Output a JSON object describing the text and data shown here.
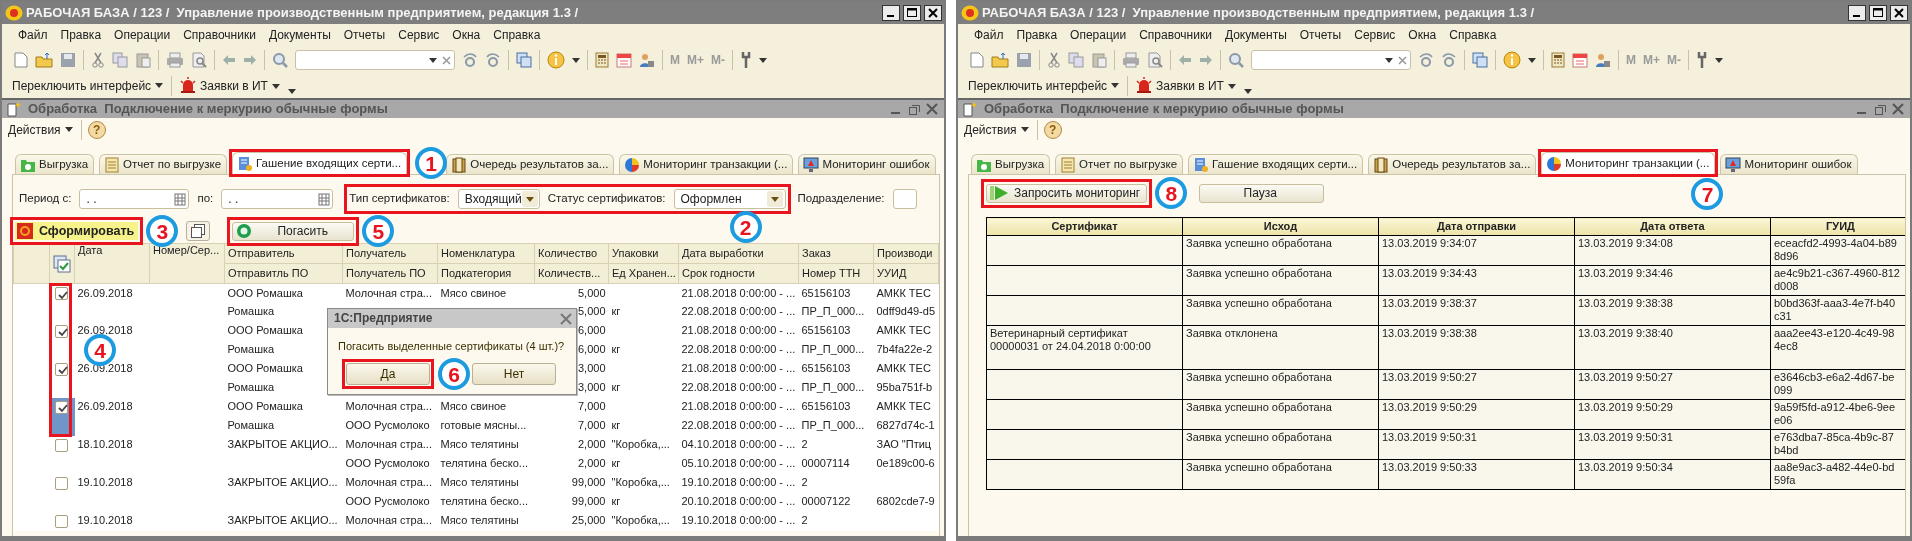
{
  "windows": [
    {
      "title": "РАБОЧАЯ БАЗА / 123 /  Управление производственным предприятием, редакция 1.3 /",
      "menu": [
        "Файл",
        "Правка",
        "Операции",
        "Справочники",
        "Документы",
        "Отчеты",
        "Сервис",
        "Окна",
        "Справка"
      ],
      "memory_buttons": [
        "M",
        "M+",
        "M-"
      ],
      "interface_switch": "Переключить интерфейс",
      "requests": "Заявки в ИТ",
      "form_title": "Обработка  Подключение к меркурию обычные формы",
      "actions": "Действия",
      "help": "?",
      "tabs": [
        {
          "label": "Выгрузка",
          "selected": false,
          "marked": false
        },
        {
          "label": "Отчет по выгрузке",
          "selected": false,
          "marked": false
        },
        {
          "label": "Гашение входящих серти...",
          "selected": true,
          "marked": true,
          "callout": "1"
        },
        {
          "label": "Очередь результатов за...",
          "selected": false,
          "marked": false
        },
        {
          "label": "Мониторинг транзакции (...",
          "selected": false,
          "marked": false
        },
        {
          "label": "Мониторинг ошибок",
          "selected": false,
          "marked": false
        }
      ],
      "panel": {
        "kind": "certificates",
        "filters": {
          "from_label": "Период с:",
          "from": ". .",
          "to_label": "по:",
          "to": ". .",
          "type_label": "Тип сертификатов:",
          "type": "Входящий",
          "status_label": "Статус сертификатов:",
          "status": "Оформлен",
          "division_label": "Подразделение:",
          "marked": true,
          "callout": "2"
        },
        "build_button": {
          "label": "Сформировать",
          "marked": true,
          "callout": "3"
        },
        "redeem_button": {
          "label": "Погасить",
          "marked": true,
          "callout": "5"
        },
        "checkbox_column": {
          "marked": true,
          "callout": "4"
        },
        "columns": [
          {
            "top": "Дата"
          },
          {
            "top": "Номер/Сер..."
          },
          {
            "top": "Отправитель",
            "bottom": "Отправитль ПО"
          },
          {
            "top": "Получатель",
            "bottom": "Получатель ПО"
          },
          {
            "top": "Номенклатура",
            "bottom": "Подкатегория"
          },
          {
            "top": "Количество",
            "bottom": "Количеств..."
          },
          {
            "top": "Упаковки",
            "bottom": "Ед Хранен..."
          },
          {
            "top": "Дата выработки",
            "bottom": "Срок годности"
          },
          {
            "top": "Заказ",
            "bottom": "Номер ТТН"
          },
          {
            "top": "Производи",
            "bottom": "УУИД"
          }
        ],
        "records": [
          {
            "checked": true,
            "selected": false,
            "lines": [
              {
                "date": "26.09.2018",
                "sender": "ООО Ромашка",
                "recipient": "Молочная стра...",
                "item": "Мясо свиное",
                "quantity": "5,000",
                "production_date": "21.08.2018 0:00:00 - ...",
                "order": "65156103",
                "producer": "АМКК ТЕС"
              },
              {
                "sender": "Ромашка",
                "quantity": "5,000",
                "packing": "кг",
                "production_date": "22.08.2018 0:00:00 - ...",
                "order": "ПР_П_000...",
                "producer": "0dff9d49-d5"
              }
            ]
          },
          {
            "checked": true,
            "selected": false,
            "lines": [
              {
                "date": "26.09.2018",
                "sender": "ООО Ромашка",
                "quantity": "6,000",
                "production_date": "21.08.2018 0:00:00 - ...",
                "order": "65156103",
                "producer": "АМКК ТЕС"
              },
              {
                "sender": "Ромашка",
                "quantity": "6,000",
                "packing": "кг",
                "production_date": "22.08.2018 0:00:00 - ...",
                "order": "ПР_П_000...",
                "producer": "7b4fa22e-2"
              }
            ]
          },
          {
            "checked": true,
            "selected": false,
            "lines": [
              {
                "date": "26.09.2018",
                "sender": "ООО Ромашка",
                "quantity": "3,000",
                "production_date": "21.08.2018 0:00:00 - ...",
                "order": "65156103",
                "producer": "АМКК ТЕС"
              },
              {
                "sender": "Ромашка",
                "quantity": "3,000",
                "packing": "кг",
                "production_date": "22.08.2018 0:00:00 - ...",
                "order": "ПР_П_000...",
                "producer": "95ba751f-b"
              }
            ]
          },
          {
            "checked": true,
            "selected": true,
            "lines": [
              {
                "date": "26.09.2018",
                "sender": "ООО Ромашка",
                "recipient": "Молочная стра...",
                "item": "Мясо свиное",
                "quantity": "7,000",
                "production_date": "21.08.2018 0:00:00 - ...",
                "order": "65156103",
                "producer": "АМКК ТЕС"
              },
              {
                "sender": "Ромашка",
                "recipient": "ООО Русмолоко",
                "item": "готовые мясны...",
                "quantity": "7,000",
                "packing": "кг",
                "production_date": "22.08.2018 0:00:00 - ...",
                "order": "ПР_П_000...",
                "producer": "6827d74c-1"
              }
            ]
          },
          {
            "checked": false,
            "selected": false,
            "lines": [
              {
                "date": "18.10.2018",
                "sender": "ЗАКРЫТОЕ АКЦИО...",
                "recipient": "Молочная стра...",
                "item": "Мясо телятины",
                "quantity": "2,000",
                "packing": "\"Коробка,...",
                "production_date": "04.10.2018 0:00:00 - ...",
                "order": "2",
                "producer": "ЗАО \"Птиц"
              },
              {
                "recipient": "ООО Русмолоко",
                "item": "телятина беско...",
                "quantity": "2,000",
                "packing": "кг",
                "production_date": "05.10.2018 0:00:00 - ...",
                "order": "00007114",
                "producer": "0e189c00-6"
              }
            ]
          },
          {
            "checked": false,
            "selected": false,
            "lines": [
              {
                "date": "19.10.2018",
                "sender": "ЗАКРЫТОЕ АКЦИО...",
                "recipient": "Молочная стра...",
                "item": "Мясо телятины",
                "quantity": "99,000",
                "packing": "\"Коробка,...",
                "production_date": "19.10.2018 0:00:00 - ...",
                "order": "2"
              },
              {
                "recipient": "ООО Русмолоко",
                "item": "телятина беско...",
                "quantity": "99,000",
                "packing": "кг",
                "production_date": "20.10.2018 0:00:00 - ...",
                "order": "00007122",
                "producer": "6802cde7-9"
              }
            ]
          },
          {
            "checked": false,
            "selected": false,
            "lines": [
              {
                "date": "19.10.2018",
                "sender": "ЗАКРЫТОЕ АКЦИО...",
                "recipient": "Молочная стра...",
                "item": "Мясо телятины",
                "quantity": "25,000",
                "packing": "\"Коробка,...",
                "production_date": "19.10.2018 0:00:00 - ...",
                "order": "2"
              }
            ]
          }
        ],
        "dialog": {
          "title": "1С:Предприятие",
          "message": "Погасить выделенные сертификаты (4 шт.)?",
          "buttons": [
            {
              "label": "Да",
              "marked": true,
              "callout": "6"
            },
            {
              "label": "Нет",
              "marked": false
            }
          ]
        }
      }
    },
    {
      "title": "РАБОЧАЯ БАЗА / 123 /  Управление производственным предприятием, редакция 1.3 /",
      "menu": [
        "Файл",
        "Правка",
        "Операции",
        "Справочники",
        "Документы",
        "Отчеты",
        "Сервис",
        "Окна",
        "Справка"
      ],
      "memory_buttons": [
        "M",
        "M+",
        "M-"
      ],
      "interface_switch": "Переключить интерфейс",
      "requests": "Заявки в ИТ",
      "form_title": "Обработка  Подключение к меркурию обычные формы",
      "actions": "Действия",
      "help": "?",
      "tabs": [
        {
          "label": "Выгрузка",
          "selected": false,
          "marked": false
        },
        {
          "label": "Отчет по выгрузке",
          "selected": false,
          "marked": false
        },
        {
          "label": "Гашение входящих серти...",
          "selected": false,
          "marked": false
        },
        {
          "label": "Очередь результатов за...",
          "selected": false,
          "marked": false
        },
        {
          "label": "Мониторинг транзакции (...",
          "selected": true,
          "marked": true,
          "callout": "7"
        },
        {
          "label": "Мониторинг ошибок",
          "selected": false,
          "marked": false
        }
      ],
      "panel": {
        "kind": "monitoring",
        "request_button": {
          "label": "Запросить мониторинг",
          "marked": true,
          "callout": "8"
        },
        "pause_button": {
          "label": "Пауза"
        },
        "columns": [
          "Сертификат",
          "Исход",
          "Дата отправки",
          "Дата ответа",
          "ГУИД"
        ],
        "rows": [
          {
            "result": "Заявка успешно обработана",
            "sent": "13.03.2019 9:34:07",
            "answered": "13.03.2019 9:34:08",
            "guid": [
              "eceacfd2-4993-4a04-b89",
              "8d96"
            ]
          },
          {
            "result": "Заявка успешно обработана",
            "sent": "13.03.2019 9:34:43",
            "answered": "13.03.2019 9:34:46",
            "guid": [
              "ae4c9b21-c367-4960-812",
              "d008"
            ]
          },
          {
            "result": "Заявка успешно обработана",
            "sent": "13.03.2019 9:38:37",
            "answered": "13.03.2019 9:38:38",
            "guid": [
              "b0bd363f-aaa3-4e7f-b40",
              "c31"
            ]
          },
          {
            "certificate": [
              "Ветеринарный сертификат",
              "00000031 от 24.04.2018 0:00:00"
            ],
            "result": "Заявка отклонена",
            "sent": "13.03.2019 9:38:38",
            "answered": "13.03.2019 9:38:40",
            "guid": [
              "aaa2ee43-e120-4c49-98",
              "4ec8"
            ]
          },
          {
            "result": "Заявка успешно обработана",
            "sent": "13.03.2019 9:50:27",
            "answered": "13.03.2019 9:50:27",
            "guid": [
              "e3646cb3-e6a2-4d67-be",
              "099"
            ]
          },
          {
            "result": "Заявка успешно обработана",
            "sent": "13.03.2019 9:50:29",
            "answered": "13.03.2019 9:50:29",
            "guid": [
              "9a59f5fd-a912-4be6-9ee",
              "e06"
            ]
          },
          {
            "result": "Заявка успешно обработана",
            "sent": "13.03.2019 9:50:31",
            "answered": "13.03.2019 9:50:31",
            "guid": [
              "e763dba7-85ca-4b9c-87",
              "b4bd"
            ]
          },
          {
            "result": "Заявка успешно обработана",
            "sent": "13.03.2019 9:50:33",
            "answered": "13.03.2019 9:50:34",
            "guid": [
              "aa8e9ac3-a482-44e0-bd",
              "59fa"
            ]
          }
        ]
      }
    }
  ]
}
